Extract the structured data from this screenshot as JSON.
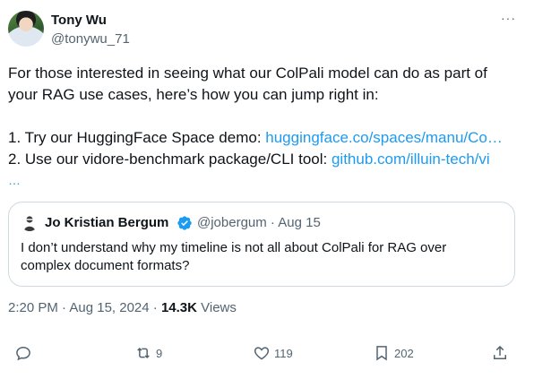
{
  "tweet": {
    "author_name": "Tony Wu",
    "author_handle": "@tonywu_71",
    "more_icon": "···",
    "lines": [
      "For those interested in seeing what our ColPali model can do as part of",
      "your RAG use cases, here’s how you can jump right in:"
    ],
    "list": [
      {
        "prefix": "1. Try our HuggingFace Space demo: ",
        "link": "huggingface.co/spaces/manu/Co…"
      },
      {
        "prefix": "2. Use our vidore-benchmark package/CLI tool: ",
        "link": "github.com/illuin-tech/vi"
      }
    ],
    "truncation": "…",
    "timestamp": "2:20 PM · Aug 15, 2024 · ",
    "views_count": "14.3K",
    "views_label": " Views"
  },
  "quote": {
    "author_name": "Jo Kristian Bergum",
    "meta": "@jobergum · Aug 15",
    "text": "I don’t understand why my timeline is not all about ColPali for RAG over complex document formats?"
  },
  "actions": {
    "reply_count": "",
    "retweet_count": "9",
    "like_count": "119",
    "bookmark_count": "202"
  },
  "colors": {
    "link": "#1d9bf0",
    "secondary_text": "#536471",
    "border": "#cfd9de"
  }
}
